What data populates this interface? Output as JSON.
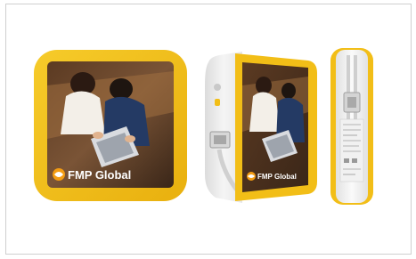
{
  "brand": {
    "name": "FMP Global",
    "accent_yellow": "#F2BE17",
    "shell_white": "#EDEDED"
  },
  "views": [
    "front-view",
    "angled-view",
    "side-view"
  ]
}
